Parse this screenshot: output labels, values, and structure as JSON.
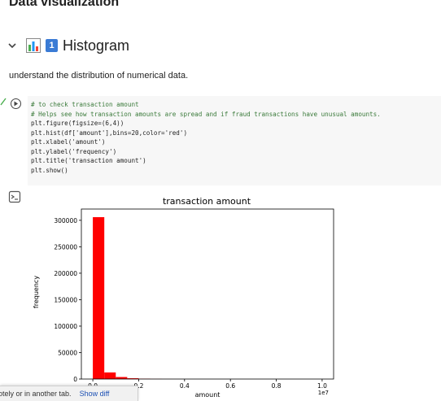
{
  "page": {
    "top_heading": "Data visualization"
  },
  "section": {
    "number": "1",
    "title": "Histogram"
  },
  "text_cell": {
    "text": "understand the distribution of numerical data."
  },
  "code_cell": {
    "lines": [
      "# to check transaction amount",
      "# Helps see how transaction amounts are spread and if fraud transactions have unusual amounts.",
      "plt.figure(figsize=(6,4))",
      "plt.hist(df['amount'],bins=20,color='red')",
      "plt.xlabel('amount')",
      "plt.ylabel('frequency')",
      "plt.title('transaction amount')",
      "plt.show()"
    ]
  },
  "chart_data": {
    "type": "bar",
    "title": "transaction amount",
    "xlabel": "amount",
    "ylabel": "frequency",
    "x_offset_text": "1e7",
    "bar_color": "#ff0000",
    "bin_edges": [
      0.0,
      0.05,
      0.1,
      0.15,
      0.2,
      0.25,
      0.3,
      0.35,
      0.4,
      0.45,
      0.5,
      0.55,
      0.6,
      0.65,
      0.7,
      0.75,
      0.8,
      0.85,
      0.9,
      0.95,
      1.0
    ],
    "values": [
      306000,
      12500,
      3800,
      1500,
      700,
      250,
      80,
      20,
      5,
      2,
      1,
      0,
      0,
      0,
      0,
      0,
      0,
      0,
      0,
      0
    ],
    "xlim": [
      -0.05,
      1.05
    ],
    "ylim": [
      0,
      321300
    ],
    "xticks": [
      0.0,
      0.2,
      0.4,
      0.6,
      0.8,
      1.0
    ],
    "xtick_labels": [
      "0.0",
      "0.2",
      "0.4",
      "0.6",
      "0.8",
      "1.0"
    ],
    "yticks": [
      0,
      50000,
      100000,
      150000,
      200000,
      250000,
      300000
    ],
    "ytick_labels": [
      "0",
      "50000",
      "100000",
      "150000",
      "200000",
      "250000",
      "300000"
    ],
    "grid": false
  },
  "toast": {
    "text": "otely or in another tab.",
    "link": "Show diff"
  }
}
